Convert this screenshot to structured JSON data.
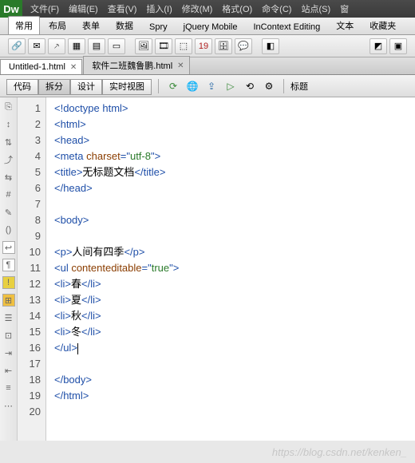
{
  "logo": "Dw",
  "menu": [
    "文件(F)",
    "编辑(E)",
    "查看(V)",
    "插入(I)",
    "修改(M)",
    "格式(O)",
    "命令(C)",
    "站点(S)"
  ],
  "menu_cut": "窗",
  "categories": [
    "常用",
    "布局",
    "表单",
    "数据",
    "Spry",
    "jQuery Mobile",
    "InContext Editing",
    "文本",
    "收藏夹"
  ],
  "active_category": 0,
  "doc_tabs": [
    {
      "label": "Untitled-1.html",
      "active": true
    },
    {
      "label": "软件二班魏鲁鹏.html",
      "active": false
    }
  ],
  "view_buttons": [
    "代码",
    "拆分",
    "设计",
    "实时视图"
  ],
  "active_view": 1,
  "title_label": "标题",
  "code_lines": [
    [
      {
        "cls": "t-tag",
        "t": "<!doctype html>"
      }
    ],
    [
      {
        "cls": "t-tag",
        "t": "<html>"
      }
    ],
    [
      {
        "cls": "t-tag",
        "t": "<head>"
      }
    ],
    [
      {
        "cls": "t-tag",
        "t": "<meta "
      },
      {
        "cls": "t-attr",
        "t": "charset"
      },
      {
        "cls": "t-tag",
        "t": "=\""
      },
      {
        "cls": "t-str",
        "t": "utf-8"
      },
      {
        "cls": "t-tag",
        "t": "\">"
      }
    ],
    [
      {
        "cls": "t-tag",
        "t": "<title>"
      },
      {
        "cls": "t-text",
        "t": "无标题文档"
      },
      {
        "cls": "t-tag",
        "t": "</title>"
      }
    ],
    [
      {
        "cls": "t-tag",
        "t": "</head>"
      }
    ],
    [],
    [
      {
        "cls": "t-tag",
        "t": "<body>"
      }
    ],
    [],
    [
      {
        "cls": "t-tag",
        "t": "<p>"
      },
      {
        "cls": "t-text",
        "t": "人间有四季"
      },
      {
        "cls": "t-tag",
        "t": "</p>"
      }
    ],
    [
      {
        "cls": "t-tag",
        "t": "<ul "
      },
      {
        "cls": "t-attr",
        "t": "contenteditable"
      },
      {
        "cls": "t-tag",
        "t": "=\""
      },
      {
        "cls": "t-str",
        "t": "true"
      },
      {
        "cls": "t-tag",
        "t": "\">"
      }
    ],
    [
      {
        "cls": "t-tag",
        "t": "<li>"
      },
      {
        "cls": "t-text",
        "t": "春"
      },
      {
        "cls": "t-tag",
        "t": "</li>"
      }
    ],
    [
      {
        "cls": "t-tag",
        "t": "<li>"
      },
      {
        "cls": "t-text",
        "t": "夏"
      },
      {
        "cls": "t-tag",
        "t": "</li>"
      }
    ],
    [
      {
        "cls": "t-tag",
        "t": "<li>"
      },
      {
        "cls": "t-text",
        "t": "秋"
      },
      {
        "cls": "t-tag",
        "t": "</li>"
      }
    ],
    [
      {
        "cls": "t-tag",
        "t": "<li>"
      },
      {
        "cls": "t-text",
        "t": "冬"
      },
      {
        "cls": "t-tag",
        "t": "</li>"
      }
    ],
    [
      {
        "cls": "t-tag",
        "t": "</ul>"
      },
      {
        "cls": "cursor",
        "t": ""
      }
    ],
    [],
    [
      {
        "cls": "t-tag",
        "t": "</body>"
      }
    ],
    [
      {
        "cls": "t-tag",
        "t": "</html>"
      }
    ],
    []
  ],
  "watermark": "https://blog.csdn.net/kenken_"
}
